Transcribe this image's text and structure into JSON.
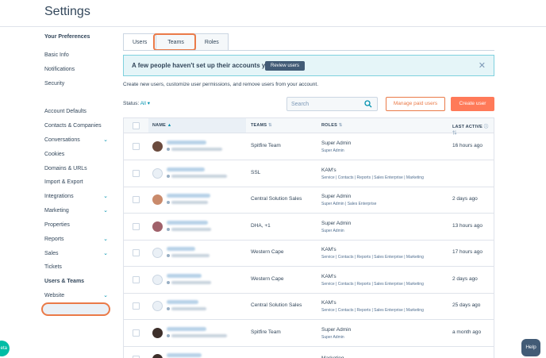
{
  "page": {
    "title": "Settings"
  },
  "sidebar": {
    "section_title": "Your Preferences",
    "items": [
      {
        "label": "Basic Info",
        "chevron": false
      },
      {
        "label": "Notifications",
        "chevron": false
      },
      {
        "label": "Security",
        "chevron": false
      },
      {
        "label": "Account Defaults",
        "chevron": false
      },
      {
        "label": "Contacts & Companies",
        "chevron": false
      },
      {
        "label": "Conversations",
        "chevron": true
      },
      {
        "label": "Cookies",
        "chevron": false
      },
      {
        "label": "Domains & URLs",
        "chevron": false
      },
      {
        "label": "Import & Export",
        "chevron": false
      },
      {
        "label": "Integrations",
        "chevron": true
      },
      {
        "label": "Marketing",
        "chevron": true
      },
      {
        "label": "Properties",
        "chevron": false
      },
      {
        "label": "Reports",
        "chevron": true
      },
      {
        "label": "Sales",
        "chevron": true
      },
      {
        "label": "Tickets",
        "chevron": false
      },
      {
        "label": "Users & Teams",
        "chevron": false
      },
      {
        "label": "Website",
        "chevron": true
      }
    ],
    "active_item": "Users & Teams"
  },
  "tabs": [
    {
      "label": "Users",
      "active": true
    },
    {
      "label": "Teams",
      "active": false
    },
    {
      "label": "Roles",
      "active": false
    }
  ],
  "banner": {
    "text": "A few people haven't set up their accounts yet.",
    "button": "Review users"
  },
  "description": "Create new users, customize user permissions, and remove users from your account.",
  "filter": {
    "label": "Status:",
    "value": "All"
  },
  "search": {
    "placeholder": "Search"
  },
  "buttons": {
    "manage_paid": "Manage paid users",
    "create_user": "Create user"
  },
  "table": {
    "columns": {
      "name": "NAME",
      "teams": "TEAMS",
      "roles": "ROLES",
      "last_active": "LAST ACTIVE"
    },
    "rows": [
      {
        "team": "Spitfire Team",
        "role": "Super Admin",
        "role_detail": "Super Admin",
        "last_active": "16 hours ago",
        "avatar_color": "#6b4b3e"
      },
      {
        "team": "SSL",
        "role": "KAM's",
        "role_detail": "Service | Contacts | Reports | Sales Enterprise | Marketing",
        "last_active": "",
        "avatar_color": "#eaf0f6"
      },
      {
        "team": "Central Solution Sales",
        "role": "Super Admin",
        "role_detail": "Super Admin | Sales Enterprise",
        "last_active": "2 days ago",
        "avatar_color": "#c98a6b"
      },
      {
        "team": "DHA, +1",
        "role": "Super Admin",
        "role_detail": "Super Admin",
        "last_active": "13 hours ago",
        "avatar_color": "#a0616a"
      },
      {
        "team": "Western Cape",
        "role": "KAM's",
        "role_detail": "Service | Contacts | Reports | Sales Enterprise | Marketing",
        "last_active": "17 hours ago",
        "avatar_color": "#eaf0f6"
      },
      {
        "team": "Western Cape",
        "role": "KAM's",
        "role_detail": "Service | Contacts | Reports | Sales Enterprise | Marketing",
        "last_active": "2 days ago",
        "avatar_color": "#eaf0f6"
      },
      {
        "team": "Central Solution Sales",
        "role": "KAM's",
        "role_detail": "Service | Contacts | Reports | Sales Enterprise | Marketing",
        "last_active": "25 days ago",
        "avatar_color": "#eaf0f6"
      },
      {
        "team": "Spitfire Team",
        "role": "Super Admin",
        "role_detail": "Super Admin",
        "last_active": "a month ago",
        "avatar_color": "#3d2f2a"
      },
      {
        "team": "",
        "role": "Marketing",
        "role_detail": "",
        "last_active": "",
        "avatar_color": "#3d2f2a"
      }
    ]
  },
  "help": {
    "label": "Help"
  },
  "beta": {
    "label": "eta"
  }
}
